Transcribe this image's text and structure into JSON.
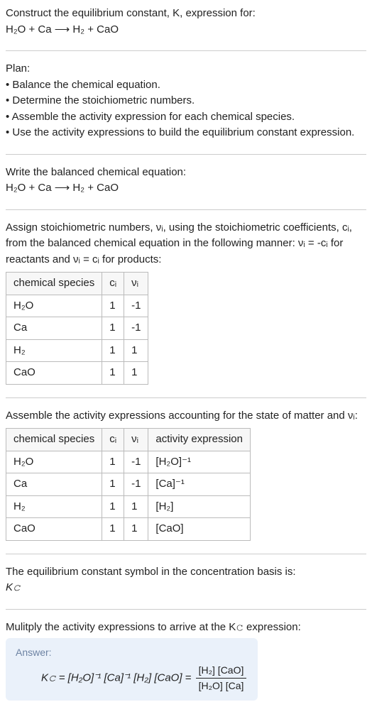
{
  "intro": {
    "line1": "Construct the equilibrium constant, K, expression for:",
    "equation": "H₂O + Ca ⟶ H₂ + CaO"
  },
  "plan": {
    "title": "Plan:",
    "items": [
      "Balance the chemical equation.",
      "Determine the stoichiometric numbers.",
      "Assemble the activity expression for each chemical species.",
      "Use the activity expressions to build the equilibrium constant expression."
    ]
  },
  "balanced": {
    "title": "Write the balanced chemical equation:",
    "equation": "H₂O + Ca ⟶ H₂ + CaO"
  },
  "stoich": {
    "intro": "Assign stoichiometric numbers, νᵢ, using the stoichiometric coefficients, cᵢ, from the balanced chemical equation in the following manner: νᵢ = -cᵢ for reactants and νᵢ = cᵢ for products:",
    "headers": [
      "chemical species",
      "cᵢ",
      "νᵢ"
    ],
    "rows": [
      [
        "H₂O",
        "1",
        "-1"
      ],
      [
        "Ca",
        "1",
        "-1"
      ],
      [
        "H₂",
        "1",
        "1"
      ],
      [
        "CaO",
        "1",
        "1"
      ]
    ]
  },
  "activity": {
    "intro": "Assemble the activity expressions accounting for the state of matter and νᵢ:",
    "headers": [
      "chemical species",
      "cᵢ",
      "νᵢ",
      "activity expression"
    ],
    "rows": [
      [
        "H₂O",
        "1",
        "-1",
        "[H₂O]⁻¹"
      ],
      [
        "Ca",
        "1",
        "-1",
        "[Ca]⁻¹"
      ],
      [
        "H₂",
        "1",
        "1",
        "[H₂]"
      ],
      [
        "CaO",
        "1",
        "1",
        "[CaO]"
      ]
    ]
  },
  "symbolSection": {
    "text": "The equilibrium constant symbol in the concentration basis is:",
    "symbol": "K𝚌"
  },
  "final": {
    "intro": "Mulitply the activity expressions to arrive at the K𝚌 expression:",
    "answerLabel": "Answer:",
    "lhs": "K𝚌 = [H₂O]⁻¹ [Ca]⁻¹ [H₂] [CaO] = ",
    "fracNum": "[H₂] [CaO]",
    "fracDen": "[H₂O] [Ca]"
  }
}
